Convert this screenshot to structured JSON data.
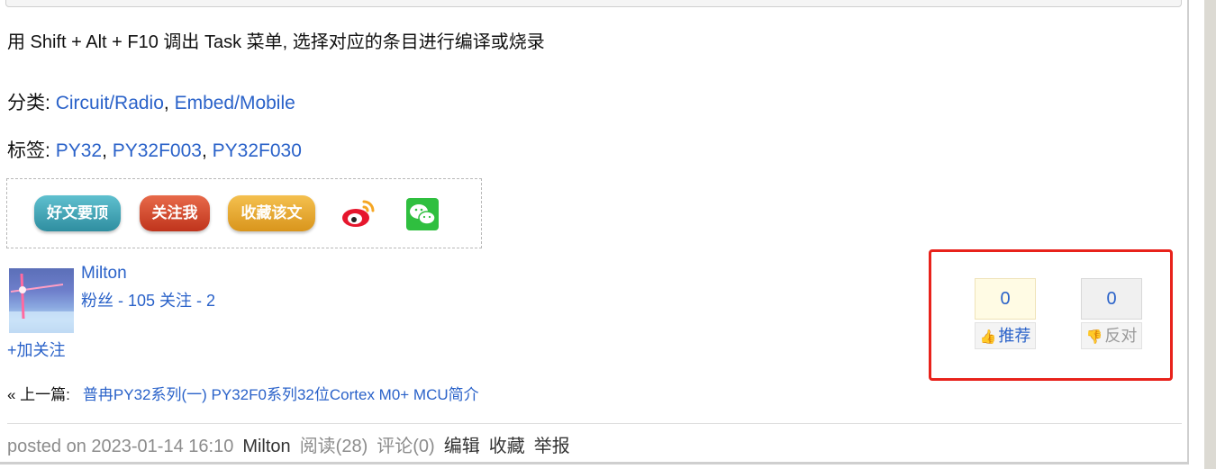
{
  "article": {
    "paragraph": "用 Shift + Alt + F10 调出 Task 菜单, 选择对应的条目进行编译或烧录",
    "categories_label": "分类:",
    "categories": [
      "Circuit/Radio",
      "Embed/Mobile"
    ],
    "tags_label": "标签:",
    "tags": [
      "PY32",
      "PY32F003",
      "PY32F030"
    ]
  },
  "share": {
    "good_post": "好文要顶",
    "follow_me": "关注我",
    "favorite": "收藏该文",
    "icons": [
      "weibo-icon",
      "wechat-icon"
    ]
  },
  "author": {
    "name": "Milton",
    "fans_label": "粉丝 - 105",
    "following_label": "关注 - 2",
    "add_follow": "+加关注"
  },
  "prev": {
    "prefix": "« 上一篇:",
    "title": "普冉PY32系列(一) PY32F0系列32位Cortex M0+ MCU简介"
  },
  "votes": {
    "up_count": "0",
    "up_label": "推荐",
    "down_count": "0",
    "down_label": "反对"
  },
  "postinfo": {
    "posted": "posted on 2023-01-14 16:10",
    "author": "Milton",
    "reads": "阅读(28)",
    "comments": "评论(0)",
    "edit": "编辑",
    "favorite": "收藏",
    "report": "举报"
  },
  "colors": {
    "link": "#2a62c9",
    "highlight": "#e8221b"
  }
}
